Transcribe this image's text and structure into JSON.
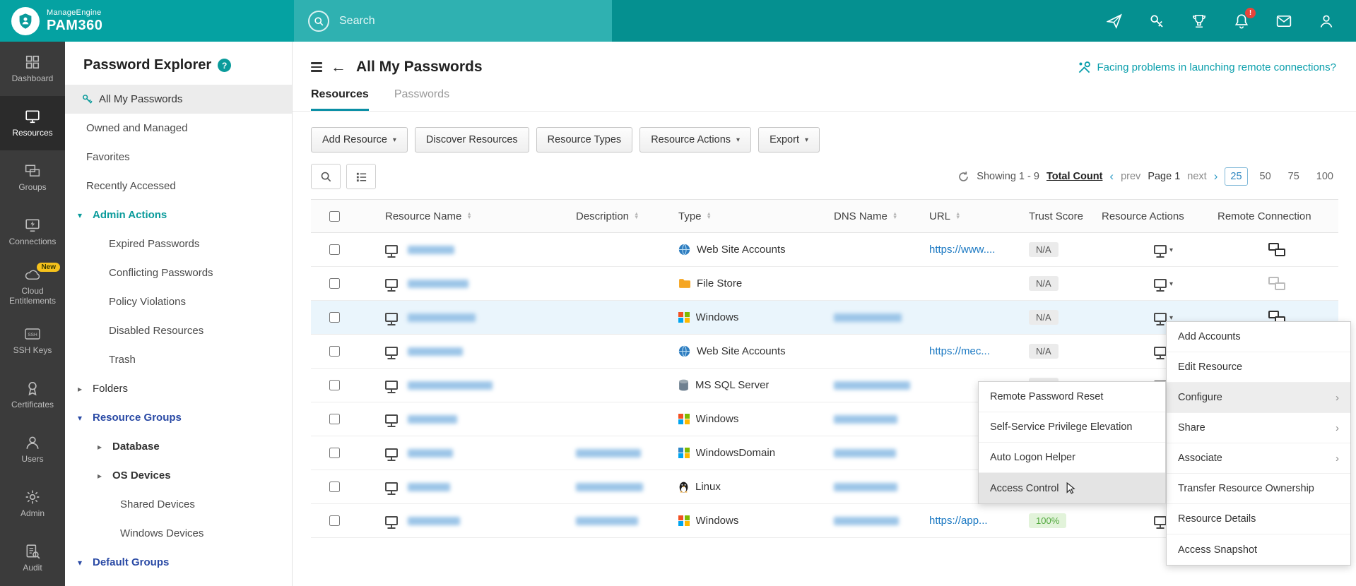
{
  "colors": {
    "accent": "#0A9B9B",
    "link": "#1A78C2",
    "trust_good": "#53A93F"
  },
  "icons": {
    "caret_down": "▾",
    "sort_asc": "▲",
    "sort_desc": "▼",
    "chevron_left": "‹",
    "chevron_right": "›",
    "back_arrow": "←",
    "tri_collapsed": "▸",
    "tri_expanded": "▾",
    "submenu_arrow": "›",
    "help": "?"
  },
  "topbar": {
    "brand_line1": "ManageEngine",
    "brand_line2": "PAM360",
    "search_placeholder": "Search",
    "notification_badge": "!"
  },
  "leftnav": {
    "items": [
      {
        "label": "Dashboard"
      },
      {
        "label": "Resources"
      },
      {
        "label": "Groups"
      },
      {
        "label": "Connections"
      },
      {
        "label": "Cloud Entitlements",
        "badge": "New"
      },
      {
        "label": "SSH Keys"
      },
      {
        "label": "Certificates"
      },
      {
        "label": "Users"
      },
      {
        "label": "Admin"
      },
      {
        "label": "Audit"
      }
    ]
  },
  "explorer": {
    "title": "Password Explorer",
    "items": [
      "All My Passwords",
      "Owned and Managed",
      "Favorites",
      "Recently Accessed",
      "Admin Actions",
      "Expired Passwords",
      "Conflicting Passwords",
      "Policy Violations",
      "Disabled Resources",
      "Trash",
      "Folders",
      "Resource Groups",
      "Database",
      "OS Devices",
      "Shared Devices",
      "Windows Devices",
      "Default Groups"
    ]
  },
  "header": {
    "title": "All My Passwords",
    "help_link": "Facing problems in launching remote connections?"
  },
  "tabs": {
    "resources": "Resources",
    "passwords": "Passwords"
  },
  "toolbar": {
    "add_resource": "Add Resource",
    "discover_resources": "Discover Resources",
    "resource_types": "Resource Types",
    "resource_actions": "Resource Actions",
    "export": "Export"
  },
  "pagination": {
    "showing": "Showing 1 - 9",
    "total_count": "Total Count",
    "prev": "prev",
    "page": "Page 1",
    "next": "next",
    "sizes": [
      "25",
      "50",
      "75",
      "100"
    ],
    "active_size": "25"
  },
  "table": {
    "headers": [
      "Resource Name",
      "Description",
      "Type",
      "DNS Name",
      "URL",
      "Trust Score",
      "Resource Actions",
      "Remote Connection"
    ],
    "rows": [
      {
        "type": "Web Site Accounts",
        "url": "https://www....",
        "trust": "N/A"
      },
      {
        "type": "File Store",
        "trust": "N/A"
      },
      {
        "type": "Windows",
        "trust": "N/A"
      },
      {
        "type": "Web Site Accounts",
        "url": "https://mec...",
        "trust": "N/A"
      },
      {
        "type": "MS SQL Server",
        "trust": "N/A"
      },
      {
        "type": "Windows"
      },
      {
        "type": "WindowsDomain"
      },
      {
        "type": "Linux"
      },
      {
        "type": "Windows",
        "url": "https://app...",
        "trust": "100%"
      }
    ]
  },
  "context_menu": {
    "items": [
      "Add Accounts",
      "Edit Resource",
      "Configure",
      "Share",
      "Associate",
      "Transfer Resource Ownership",
      "Resource Details",
      "Access Snapshot"
    ]
  },
  "submenu": {
    "items": [
      "Remote Password Reset",
      "Self-Service Privilege Elevation",
      "Auto Logon Helper",
      "Access Control"
    ]
  }
}
